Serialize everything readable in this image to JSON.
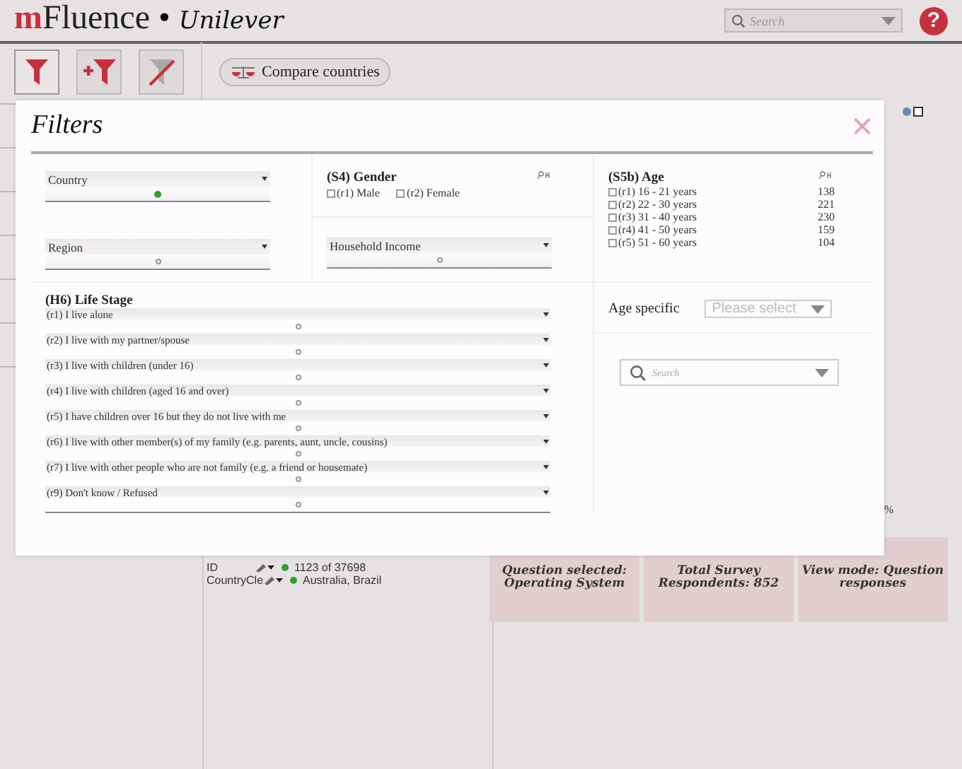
{
  "header": {
    "logo_accent": "m",
    "logo_main": "Fluence",
    "separator": "•",
    "client": "Unilever",
    "search": {
      "placeholder": "Search"
    },
    "help": "?"
  },
  "toolbar": {
    "tools": [
      {
        "kind": "filter",
        "selected": true
      },
      {
        "kind": "add-filter",
        "selected": false
      },
      {
        "kind": "clear-filter",
        "selected": false
      }
    ],
    "compare": "Compare countries"
  },
  "selections": [
    {
      "field": "ID",
      "active": true,
      "value": "1123 of 37698"
    },
    {
      "field": "CountryCle",
      "active": true,
      "value": "Australia, Brazil"
    }
  ],
  "percent_label": "%",
  "info_cards": [
    "Question selected: Operating System",
    "Total Survey Respondents: 852",
    "View mode: Question responses"
  ],
  "filters": {
    "title": "Filters",
    "close": "×",
    "dropdowns": [
      {
        "label": "Country",
        "active": true
      },
      {
        "label": "Region",
        "active": false
      }
    ],
    "gender": {
      "title": "(S4) Gender",
      "options": [
        {
          "label": "(r1) Male",
          "checked": false
        },
        {
          "label": "(r2) Female",
          "checked": false
        }
      ]
    },
    "household_income": {
      "label": "Household Income",
      "active": false
    },
    "age": {
      "title": "(S5b) Age",
      "options": [
        {
          "label": "(r1) 16 - 21 years",
          "count": "138",
          "checked": false
        },
        {
          "label": "(r2) 22 - 30 years",
          "count": "221",
          "checked": false
        },
        {
          "label": "(r3) 31 - 40 years",
          "count": "230",
          "checked": false
        },
        {
          "label": "(r4) 41 - 50 years",
          "count": "159",
          "checked": false
        },
        {
          "label": "(r5) 51 - 60 years",
          "count": "104",
          "checked": false
        }
      ]
    },
    "life_stage": {
      "title": "(H6) Life Stage",
      "items": [
        {
          "label": "(r1) I live alone",
          "active": false
        },
        {
          "label": "(r2) I live with my partner/spouse",
          "active": false
        },
        {
          "label": "(r3) I live with children (under 16)",
          "active": false
        },
        {
          "label": "(r4) I live with children (aged 16 and over)",
          "active": false
        },
        {
          "label": "(r5) I have children over 16 but they do not live with me",
          "active": false
        },
        {
          "label": "(r6) I live with other member(s) of my family (e.g. parents, aunt, uncle, cousins)",
          "active": false
        },
        {
          "label": "(r7) I live with other people who are not family (e.g. a friend or housemate)",
          "active": false
        },
        {
          "label": "(r9) Don't know / Refused",
          "active": false
        }
      ]
    },
    "age_specific": {
      "label": "Age specific",
      "placeholder": "Please select"
    },
    "search": {
      "placeholder": "Search"
    }
  }
}
